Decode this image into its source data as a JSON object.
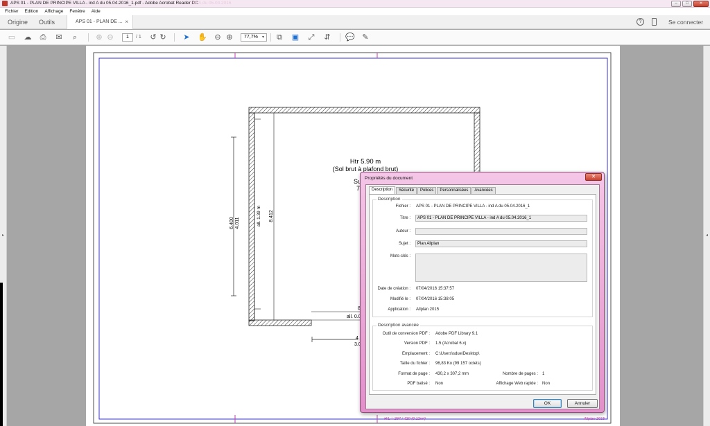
{
  "window": {
    "title": "APS 01 - PLAN DE PRINCIPE VILLA - ind A du 05.04.2016_1.pdf - Adobe Acrobat Reader DC",
    "ghost_title": "ind A du 05.04.2016",
    "controls": {
      "minimize": "–",
      "maximize": "□",
      "close": "✕"
    }
  },
  "menu": {
    "items": [
      "Fichier",
      "Edition",
      "Affichage",
      "Fenêtre",
      "Aide"
    ]
  },
  "topnav": {
    "home": "Origine",
    "tools": "Outils",
    "doc_tab": "APS 01 - PLAN DE ...",
    "doc_tab_close": "×",
    "help": "?",
    "signin": "Se connecter"
  },
  "toolbar": {
    "page_current": "1",
    "page_total": "/ 1",
    "zoom": "77,7%",
    "icons": [
      "save-icon",
      "cloud-upload-icon",
      "print-icon",
      "mail-icon",
      "search-icon",
      "page-up-icon",
      "page-down-icon",
      "rotate-ccw-icon",
      "rotate-cw-icon",
      "select-arrow-icon",
      "hand-icon",
      "zoom-out-icon",
      "zoom-in-icon",
      "fit-page-icon",
      "fit-width-icon",
      "fullscreen-icon",
      "scroll-mode-icon",
      "comment-icon",
      "sign-icon"
    ]
  },
  "drawing": {
    "room_height": "Htr 5.90 m",
    "room_floor": "(Sol brut à plafond brut)",
    "partial_su": "Su",
    "partial_7": "7",
    "dim_6400": "6.400",
    "dim_4011": "4.011",
    "dim_all139": "all. 1.39 m",
    "dim_8412": "8.412",
    "dim_all0": "all. 0.0",
    "dim_8": "8",
    "dim_4": "4.0",
    "dim_3": "3.0",
    "footer_scale": "H/L = 297 / 420 (0.12m²)",
    "footer_app": "Allplan 2015"
  },
  "dialog": {
    "title": "Propriétés du document",
    "close": "✕",
    "tabs": [
      "Description",
      "Sécurité",
      "Polices",
      "Personnalisées",
      "Avancées"
    ],
    "description": {
      "group": "Description",
      "fichier_label": "Fichier :",
      "fichier": "APS 01 - PLAN DE PRINCIPE VILLA - ind A du 05.04.2016_1",
      "titre_label": "Titre :",
      "titre": "APS 01 - PLAN DE PRINCIPE VILLA - ind A du 05.04.2016_1",
      "auteur_label": "Auteur :",
      "auteur": "",
      "sujet_label": "Sujet :",
      "sujet": "Plan Allplan",
      "mots_cles_label": "Mots-clés :",
      "mots_cles": "",
      "creation_label": "Date de création :",
      "creation": "07/04/2016 15:37:57",
      "modifie_label": "Modifié le :",
      "modifie": "07/04/2016 15:38:05",
      "application_label": "Application :",
      "application": "Allplan 2015"
    },
    "advanced": {
      "group": "Description avancée",
      "outil_label": "Outil de conversion PDF :",
      "outil": "Adobe PDF Library 9.1",
      "version_label": "Version PDF :",
      "version": "1.5 (Acrobat 6.x)",
      "emplacement_label": "Emplacement :",
      "emplacement": "C:\\Users\\sdue\\Desktop\\",
      "taille_label": "Taille du fichier :",
      "taille": "96,83 Ko (99 157 octets)",
      "format_label": "Format de page :",
      "format": "430,2 x 307,2 mm",
      "nb_pages_label": "Nombre de pages :",
      "nb_pages": "1",
      "balise_label": "PDF balisé :",
      "balise": "Non",
      "web_label": "Affichage Web rapide :",
      "web": "Non"
    },
    "ok": "OK",
    "cancel": "Annuler"
  }
}
